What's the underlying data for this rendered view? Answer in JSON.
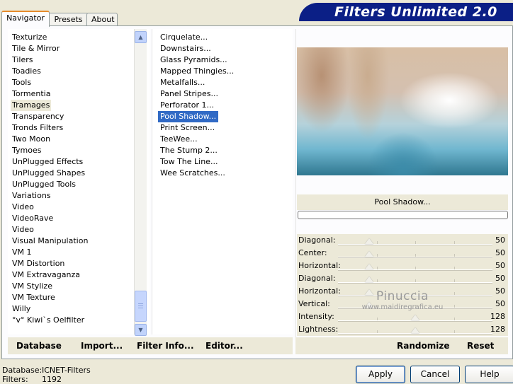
{
  "tabs": [
    "Navigator",
    "Presets",
    "About"
  ],
  "banner_title": "Filters Unlimited 2.0",
  "categories": [
    "Texturize",
    "Tile & Mirror",
    "Tilers",
    "Toadies",
    "Tools",
    "Tormentia",
    "Tramages",
    "Transparency",
    "Tronds Filters",
    "Two Moon",
    "Tymoes",
    "UnPlugged Effects",
    "UnPlugged Shapes",
    "UnPlugged Tools",
    "Variations",
    "Video",
    "VideoRave",
    "Video",
    "Visual Manipulation",
    "VM 1",
    "VM Distortion",
    "VM Extravaganza",
    "VM Stylize",
    "VM Texture",
    "Willy",
    "°v° Kiwi`s Oelfilter"
  ],
  "selected_category": "Tramages",
  "filters": [
    "Cirquelate...",
    "Downstairs...",
    "Glass Pyramids...",
    "Mapped Thingies...",
    "Metalfalls...",
    "Panel Stripes...",
    "Perforator 1...",
    "Pool Shadow...",
    "Print Screen...",
    "TeeWee...",
    "The Stump 2...",
    "Tow The Line...",
    "Wee Scratches..."
  ],
  "selected_filter": "Pool Shadow...",
  "filter_name": "Pool Shadow...",
  "progress": 0,
  "sliders": [
    {
      "label": "Diagonal:",
      "value": "50",
      "level": 0.2
    },
    {
      "label": "Center:",
      "value": "50",
      "level": 0.2
    },
    {
      "label": "Horizontal:",
      "value": "50",
      "level": 0.2
    },
    {
      "label": "Diagonal:",
      "value": "50",
      "level": 0.2
    },
    {
      "label": "Horizontal:",
      "value": "50",
      "level": 0.2
    },
    {
      "label": "Vertical:",
      "value": "50",
      "level": 0.2
    },
    {
      "label": "Intensity:",
      "value": "128",
      "level": 0.5
    },
    {
      "label": "Lightness:",
      "value": "128",
      "level": 0.5
    }
  ],
  "watermark": {
    "line1": "Pinuccia",
    "line2": "www.maidiregrafica.eu"
  },
  "bottom_left": [
    "Database",
    "Import...",
    "Filter Info...",
    "Editor..."
  ],
  "bottom_right": [
    "Randomize",
    "Reset"
  ],
  "status": {
    "db_label": "Database:",
    "db_value": "ICNET-Filters",
    "f_label": "Filters:",
    "f_value": "1192"
  },
  "buttons": {
    "apply": "Apply",
    "cancel": "Cancel",
    "help": "Help"
  },
  "colors": {
    "selection": "#316ac5",
    "banner": "#0b1f86",
    "background": "#ece9d8"
  }
}
